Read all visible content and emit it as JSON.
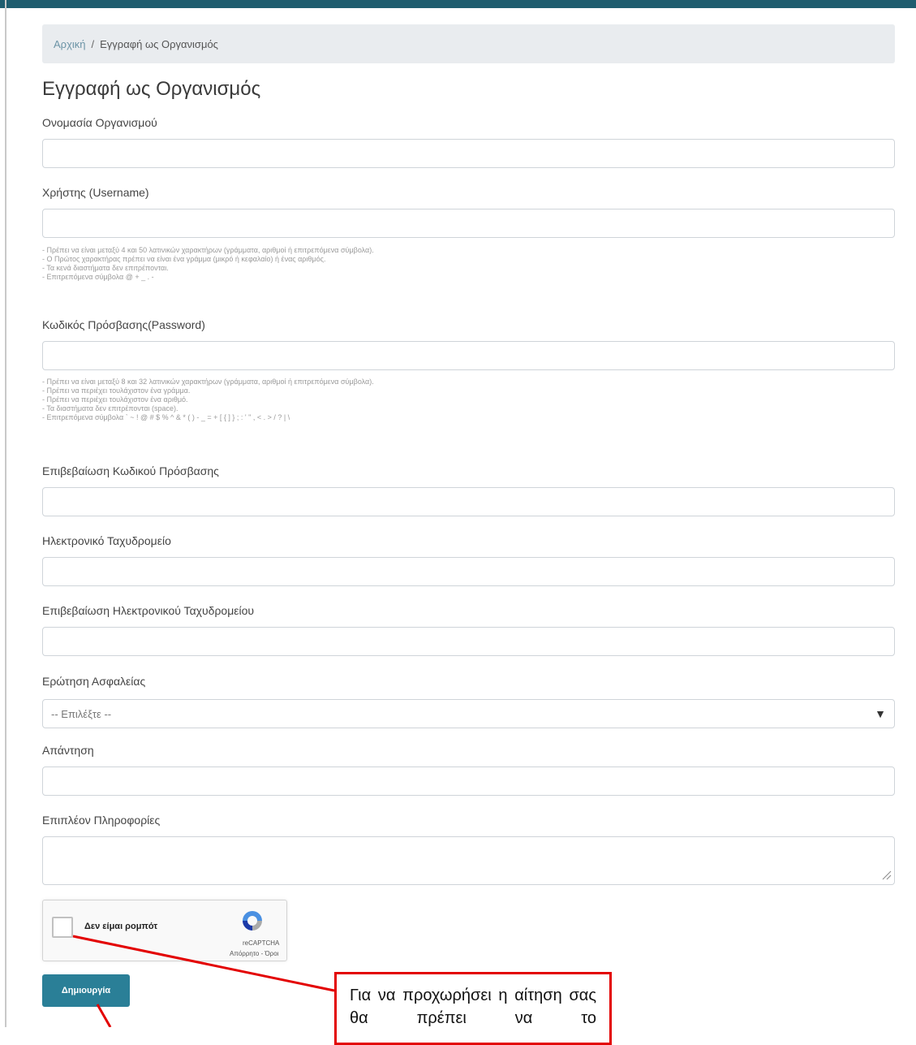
{
  "breadcrumb": {
    "home": "Αρχική",
    "separator": "/",
    "current": "Εγγραφή ως Οργανισμός"
  },
  "page_title": "Εγγραφή ως Οργανισμός",
  "fields": {
    "org_name": {
      "label": "Ονομασία Οργανισμού",
      "value": ""
    },
    "username": {
      "label": "Χρήστης (Username)",
      "value": "",
      "hints": [
        "- Πρέπει να είναι μεταξύ 4 και 50 λατινικών χαρακτήρων (γράμματα, αριθμοί ή επιτρεπόμενα σύμβολα).",
        "- Ο Πρώτος χαρακτήρας πρέπει να είναι ένα γράμμα (μικρό ή κεφαλαίο) ή ένας αριθμός.",
        "- Τα κενά διαστήματα δεν επιτρέπονται.",
        "- Επιτρεπόμενα σύμβολα @ + _ . -"
      ]
    },
    "password": {
      "label": "Κωδικός Πρόσβασης(Password)",
      "value": "",
      "hints": [
        "- Πρέπει να είναι μεταξύ 8 και 32 λατινικών χαρακτήρων (γράμματα, αριθμοί ή επιτρεπόμενα σύμβολα).",
        "- Πρέπει να περιέχει τουλάχιστον ένα γράμμα.",
        "- Πρέπει να περιέχει τουλάχιστον ένα αριθμό.",
        "- Τα διαστήματα δεν επιτρέπονται (space).",
        "- Επιτρεπόμενα σύμβολα ` ~ ! @ # $ % ^ & * ( ) - _ = + [ { ] } ; : ' \" , < . > / ? | \\"
      ]
    },
    "password_confirm": {
      "label": "Επιβεβαίωση Κωδικού Πρόσβασης",
      "value": ""
    },
    "email": {
      "label": "Ηλεκτρονικό Ταχυδρομείο",
      "value": ""
    },
    "email_confirm": {
      "label": "Επιβεβαίωση Ηλεκτρονικού Ταχυδρομείου",
      "value": ""
    },
    "security_question": {
      "label": "Ερώτηση Ασφαλείας",
      "selected": "-- Επιλέξτε --",
      "arrow": "▼"
    },
    "answer": {
      "label": "Απάντηση",
      "value": ""
    },
    "extra_info": {
      "label": "Επιπλέον Πληροφορίες",
      "value": ""
    }
  },
  "recaptcha": {
    "label": "Δεν είμαι ρομπότ",
    "brand": "reCAPTCHA",
    "privacy": "Απόρρητο - Όροι"
  },
  "submit": {
    "label": "Δημιουργία"
  },
  "annotation": {
    "text": "Για να προχωρήσει η αίτηση σας θα πρέπει να το"
  },
  "colors": {
    "topbar": "#1f5d6f",
    "button": "#2a7f97",
    "annotation_red": "#e30000"
  }
}
